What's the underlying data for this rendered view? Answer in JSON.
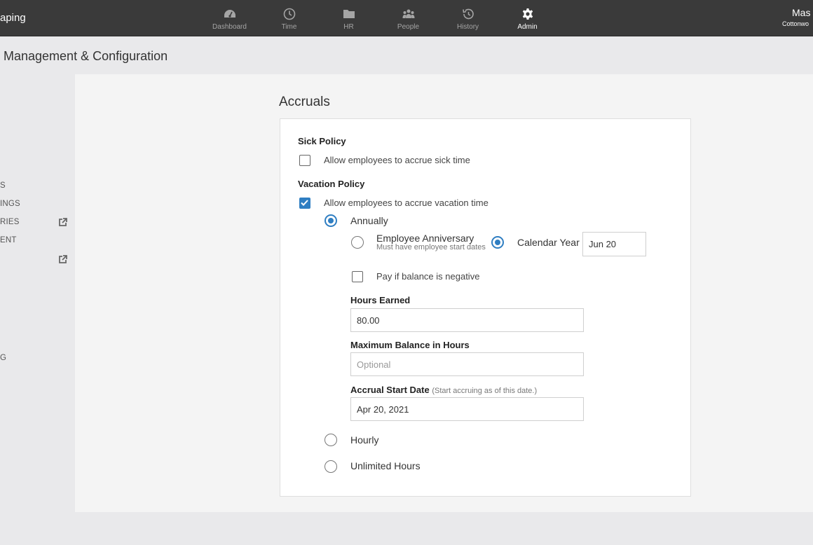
{
  "header": {
    "brand": "aping",
    "nav": [
      {
        "label": "Dashboard",
        "icon": "dashboard-icon",
        "active": false
      },
      {
        "label": "Time",
        "icon": "clock-icon",
        "active": false
      },
      {
        "label": "HR",
        "icon": "folder-icon",
        "active": false
      },
      {
        "label": "People",
        "icon": "people-icon",
        "active": false
      },
      {
        "label": "History",
        "icon": "history-icon",
        "active": false
      },
      {
        "label": "Admin",
        "icon": "gear-icon",
        "active": true
      }
    ],
    "user_name": "Mas",
    "user_org": "Cottonwo"
  },
  "page_title": "Management & Configuration",
  "sidebar": {
    "items": [
      {
        "label": "S"
      },
      {
        "label": "INGS"
      },
      {
        "label": "RIES",
        "external": true
      },
      {
        "label": "ENT"
      },
      {
        "label": "",
        "external": true
      },
      {
        "label": "G"
      }
    ]
  },
  "accruals": {
    "title": "Accruals",
    "sick": {
      "heading": "Sick Policy",
      "checkbox_label": "Allow employees to accrue sick time",
      "checked": false
    },
    "vacation": {
      "heading": "Vacation Policy",
      "checkbox_label": "Allow employees to accrue vacation time",
      "checked": true,
      "frequency_annually": "Annually",
      "employee_anniversary": "Employee Anniversary",
      "anniversary_hint": "Must have employee start dates",
      "calendar_year": "Calendar Year",
      "calendar_year_value": "Jun 20",
      "pay_negative_label": "Pay if balance is negative",
      "hours_earned_label": "Hours Earned",
      "hours_earned_value": "80.00",
      "max_balance_label": "Maximum Balance in Hours",
      "max_balance_placeholder": "Optional",
      "start_date_label": "Accrual Start Date",
      "start_date_hint": "(Start accruing as of this date.)",
      "start_date_value": "Apr 20, 2021",
      "frequency_hourly": "Hourly",
      "frequency_unlimited": "Unlimited Hours"
    }
  },
  "colors": {
    "accent": "#2f7ec2",
    "topbar": "#3a3a3a"
  }
}
